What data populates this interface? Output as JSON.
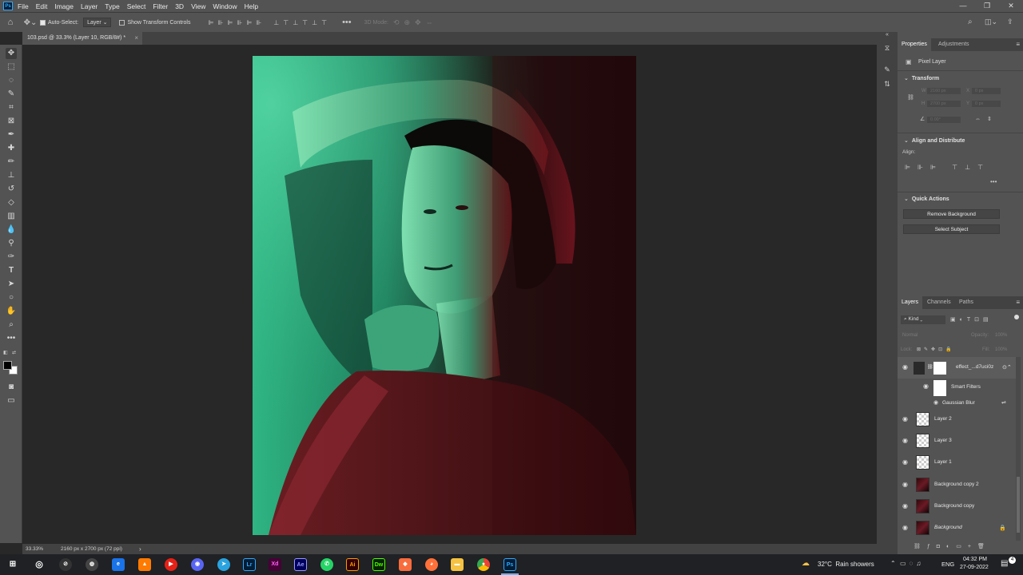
{
  "app": {
    "logo": "Ps",
    "menu": [
      "File",
      "Edit",
      "Image",
      "Layer",
      "Type",
      "Select",
      "Filter",
      "3D",
      "View",
      "Window",
      "Help"
    ],
    "window_controls": [
      "—",
      "❐",
      "✕"
    ]
  },
  "options_bar": {
    "auto_select_label": "Auto-Select:",
    "auto_select_checked": true,
    "target_select": "Layer",
    "show_transform_label": "Show Transform Controls",
    "mode_3d_label": "3D Mode:"
  },
  "document": {
    "tab_title": "103.psd @ 33.3% (Layer 10, RGB/8#) *",
    "close_glyph": "×",
    "zoom": "33.33%",
    "doc_info": "2160 px x 2700 px (72 ppi)"
  },
  "properties": {
    "tabs": [
      "Properties",
      "Adjustments"
    ],
    "type_label": "Pixel Layer",
    "transform_title": "Transform",
    "w_label": "W",
    "w_value": "2160 px",
    "h_label": "H",
    "h_value": "2700 px",
    "x_label": "X",
    "x_value": "0 px",
    "y_label": "Y",
    "y_value": "0 px",
    "angle_value": "0.00°",
    "align_title": "Align and Distribute",
    "align_label": "Align:",
    "quick_actions_title": "Quick Actions",
    "remove_background": "Remove Background",
    "select_subject": "Select Subject"
  },
  "layers_panel": {
    "tabs": [
      "Layers",
      "Channels",
      "Paths"
    ],
    "filter_kind": "Kind",
    "blend_mode": "Normal",
    "opacity_label": "Opacity:",
    "opacity_value": "100%",
    "lock_label": "Lock:",
    "fill_label": "Fill:",
    "fill_value": "100%",
    "layers": [
      {
        "name": "effect_...d7uci0z",
        "type": "smart"
      },
      {
        "name": "Smart Filters",
        "type": "smartfilters"
      },
      {
        "name": "Gaussian Blur",
        "type": "filter"
      },
      {
        "name": "Layer 2",
        "type": "transparent"
      },
      {
        "name": "Layer 3",
        "type": "transparent"
      },
      {
        "name": "Layer 1",
        "type": "transparent"
      },
      {
        "name": "Background copy 2",
        "type": "photo"
      },
      {
        "name": "Background copy",
        "type": "photo"
      },
      {
        "name": "Background",
        "type": "photo",
        "locked": true
      }
    ]
  },
  "taskbar": {
    "weather": "32°C  Rain showers",
    "language": "ENG",
    "time": "04:32 PM",
    "date": "27-09-2022",
    "apps": [
      "Lr",
      "Xd",
      "Ae",
      "Ai",
      "Dw",
      "Ps"
    ],
    "notification_count": "4"
  },
  "colors": {
    "panel_bg": "#535353",
    "canvas_bg": "#282828",
    "ps_blue": "#31a8ff",
    "accent_red": "#8a1a22",
    "accent_green": "#2fb583"
  }
}
